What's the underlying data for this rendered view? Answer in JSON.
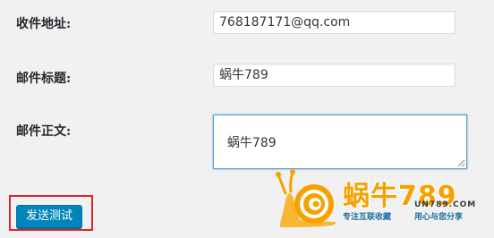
{
  "form": {
    "recipient": {
      "label": "收件地址:",
      "value": "768187171@qq.com"
    },
    "subject": {
      "label": "邮件标题:",
      "value": "蜗牛789"
    },
    "body": {
      "label": "邮件正文:",
      "value": "蜗牛789"
    },
    "send_button_label": "发送测试"
  },
  "watermark": {
    "logo_text": "蜗牛789",
    "url": "UN789.COM",
    "slogan_left": "专注互联收藏",
    "slogan_right": "用心与您分享",
    "logo_icon": "snail-icon",
    "brand_color": "#f5a200",
    "accent_color": "#1d6fa0"
  },
  "highlight_color": "#e0232b",
  "button_color": "#0085ba"
}
